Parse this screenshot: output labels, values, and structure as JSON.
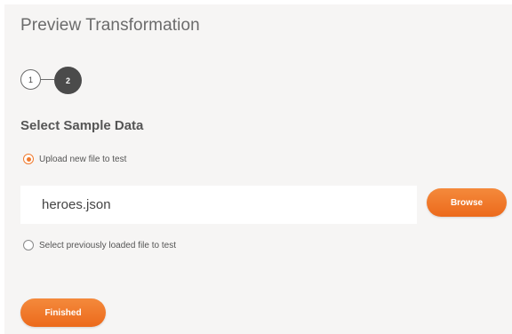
{
  "header": {
    "title": "Preview Transformation"
  },
  "stepper": {
    "steps": [
      {
        "label": "1",
        "state": "completed"
      },
      {
        "label": "2",
        "state": "active"
      }
    ]
  },
  "sample_data": {
    "section_title": "Select Sample Data",
    "options": [
      {
        "label": "Upload new file to test",
        "selected": true
      },
      {
        "label": "Select previously loaded file to test",
        "selected": false
      }
    ],
    "file_input": {
      "value": "heroes.json"
    },
    "browse_label": "Browse"
  },
  "footer": {
    "finished_label": "Finished"
  },
  "colors": {
    "accent": "#f07b2e",
    "panel_bg": "#f6f5f4",
    "active_step": "#4b4b4b"
  }
}
